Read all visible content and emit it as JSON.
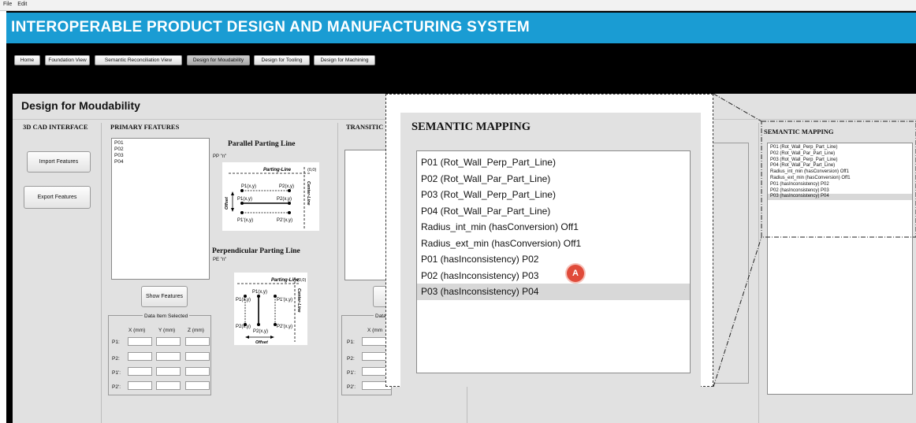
{
  "menu": {
    "file": "File",
    "edit": "Edit"
  },
  "app_title": "INTEROPERABLE PRODUCT DESIGN AND MANUFACTURING SYSTEM",
  "nav": {
    "home": "Home",
    "foundation": "Foundation View",
    "semantic": "Semantic Reconciliation View",
    "moudability": "Design for Moudability",
    "tooling": "Design for Tooling",
    "machining": "Design for Machining",
    "active": "Design for Moudability"
  },
  "page_title": "Design for Moudability",
  "sections": {
    "cad": "3D CAD INTERFACE",
    "primary": "PRIMARY FEATURES",
    "transition": "TRANSITIC"
  },
  "cad": {
    "import_label": "Import Features",
    "export_label": "Export Features"
  },
  "primary": {
    "features": [
      "P01",
      "P02",
      "P03",
      "P04"
    ],
    "show_label": "Show Features",
    "data_item_title": "Data Item Selected",
    "columns": [
      "X (mm)",
      "Y (mm)",
      "Z (mm)"
    ],
    "rows": [
      "P1:",
      "P2:",
      "P1':",
      "P2':"
    ]
  },
  "parallel": {
    "title": "Parallel Parting Line",
    "code": "PP \"n\"",
    "parting_line": "Parting-Line",
    "origin": "(0,0)",
    "center_line": "Center-Line",
    "offset": "Offset",
    "p1": "P1(x,y)",
    "p2": "P2(x,y)",
    "p1p": "P1'(x,y)",
    "p2p": "P2'(x,y)"
  },
  "perpendicular": {
    "title": "Perpendicular Parting Line",
    "code": "PE \"n\"",
    "parting_line": "Parting-Line",
    "origin": "(0,0)",
    "center_line": "Center-Line",
    "offset": "Offset",
    "p1": "P1(x,y)",
    "p2": "P2(x,y)",
    "p1p": "P1'(x,y)",
    "p2p": "P2'(x,y)"
  },
  "transition": {
    "data_title": "Data",
    "col": "X (mm",
    "rows": [
      "P1:",
      "P2:",
      "P1':",
      "P2':"
    ]
  },
  "semantic_mapping": {
    "title": "SEMANTIC MAPPING",
    "items": [
      "P01 (Rot_Wall_Perp_Part_Line)",
      "P02 (Rot_Wall_Par_Part_Line)",
      "P03 (Rot_Wall_Perp_Part_Line)",
      "P04 (Rot_Wall_Par_Part_Line)",
      "Radius_int_min (hasConversion) Off1",
      "Radius_ext_min (hasConversion) Off1",
      "P01 (hasInconsistency) P02",
      "P02 (hasInconsistency) P03",
      "P03 (hasInconsistency) P04"
    ],
    "selected_index": 8
  },
  "marker_label": "A",
  "colors": {
    "title_bar": "#1a9cd3",
    "marker": "#e04b3a",
    "panel": "#e1e1e1"
  }
}
